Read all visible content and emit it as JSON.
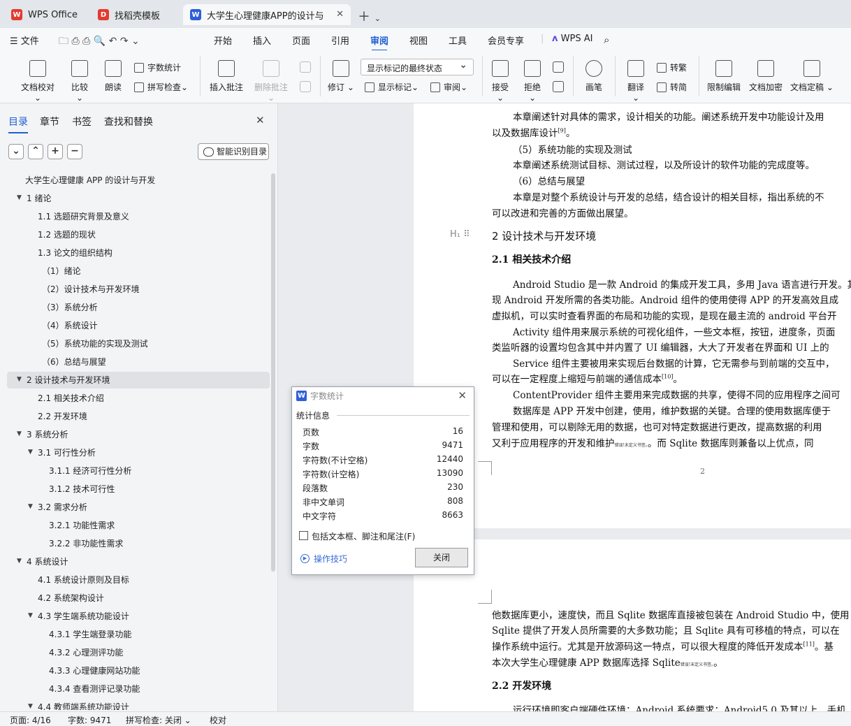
{
  "tabs": [
    {
      "label": "WPS Office",
      "color": "#e33b2e"
    },
    {
      "label": "找稻壳模板",
      "color": "#e33b2e"
    },
    {
      "label": "大学生心理健康APP的设计与",
      "color": "#2f5fd8"
    }
  ],
  "menu": {
    "file": "文件",
    "items": [
      "开始",
      "插入",
      "页面",
      "引用",
      "审阅",
      "视图",
      "工具",
      "会员专享"
    ],
    "active": "审阅",
    "wps_ai": "WPS AI"
  },
  "ribbon": {
    "doc_check": "文档校对",
    "compare": "比较",
    "read_aloud": "朗读",
    "word_count": "字数统计",
    "spell_check": "拼写检查",
    "insert_comment": "插入批注",
    "delete_comment": "删除批注",
    "revise": "修订",
    "markup_state": "显示标记的最终状态",
    "show_markup": "显示标记",
    "review": "审阅",
    "accept": "接受",
    "reject": "拒绝",
    "pen": "画笔",
    "translate": "翻译",
    "to_traditional": "转繁",
    "to_simplified": "转简",
    "restrict_edit": "限制编辑",
    "encrypt": "文档加密",
    "finalize": "文档定稿"
  },
  "sidebar": {
    "tabs": [
      "目录",
      "章节",
      "书签",
      "查找和替换"
    ],
    "smart_toc": "智能识别目录",
    "toc": [
      {
        "label": "大学生心理健康 APP 的设计与开发"
      },
      {
        "label": "1 绪论"
      },
      {
        "label": "1.1  选题研究背景及意义"
      },
      {
        "label": "1.2  选题的现状"
      },
      {
        "label": "1.3  论文的组织结构"
      },
      {
        "label": "（1）绪论"
      },
      {
        "label": "（2）设计技术与开发环境"
      },
      {
        "label": "（3）系统分析"
      },
      {
        "label": "（4）系统设计"
      },
      {
        "label": "（5）系统功能的实现及测试"
      },
      {
        "label": "（6）总结与展望"
      },
      {
        "label": "2 设计技术与开发环境"
      },
      {
        "label": "2.1 相关技术介绍"
      },
      {
        "label": "2.2 开发环境"
      },
      {
        "label": "3 系统分析"
      },
      {
        "label": "3.1 可行性分析"
      },
      {
        "label": "3.1.1 经济可行性分析"
      },
      {
        "label": "3.1.2 技术可行性"
      },
      {
        "label": "3.2 需求分析"
      },
      {
        "label": "3.2.1 功能性需求"
      },
      {
        "label": "3.2.2  非功能性需求"
      },
      {
        "label": "4 系统设计"
      },
      {
        "label": "4.1 系统设计原则及目标"
      },
      {
        "label": "4.2  系统架构设计"
      },
      {
        "label": "4.3 学生端系统功能设计"
      },
      {
        "label": "4.3.1 学生端登录功能"
      },
      {
        "label": "4.3.2 心理测评功能"
      },
      {
        "label": "4.3.3 心理健康网站功能"
      },
      {
        "label": "4.3.4  查看测评记录功能"
      },
      {
        "label": "4.4 教师端系统功能设计"
      }
    ]
  },
  "document": {
    "p1": "本章阐述针对具体的需求，设计相关的功能。阐述系统开发中功能设计及用",
    "p1b": "以及数据库设计",
    "ref9": "[9]",
    "h5": "（5）系统功能的实现及测试",
    "p2": "本章阐述系统测试目标、测试过程，以及所设计的软件功能的完成度等。",
    "h6": "（6）总结与展望",
    "p3": "本章是对整个系统设计与开发的总结，结合设计的相关目标，指出系统的不",
    "p3b": "可以改进和完善的方面做出展望。",
    "heading2": "2 设计技术与开发环境",
    "heading21": "2.1 相关技术介绍",
    "l1": "Android Studio 是一款 Android 的集成开发工具，多用 Java 语言进行开发。其",
    "l2": "现 Android 开发所需的各类功能。Android 组件的使用使得 APP 的开发高效且成",
    "l3": "虚拟机，可以实时查看界面的布局和功能的实现，是现在最主流的 android 平台开",
    "l4": "Activity 组件用来展示系统的可视化组件，一些文本框，按钮，进度条，页面",
    "l5": "类监听器的设置均包含其中并内置了 UI 编辑器，大大了开发者在界面和 UI 上的",
    "l6": "Service 组件主要被用来实现后台数据的计算，它无需参与到前端的交互中，",
    "l7": "可以在一定程度上缩短与前端的通信成本",
    "ref10": "[10]",
    "l8": "ContentProvider 组件主要用来完成数据的共享，使得不同的应用程序之间可",
    "l9": "数据库是 APP 开发中创建，使用，维护数据的关键。合理的使用数据库便于",
    "l10": "管理和使用，可以剔除无用的数据，也可对特定数据进行更改，提高数据的利用",
    "l11": "又利于应用程序的开发和维护",
    "err1": "错误!未定义书签。",
    "l11b": "。而 Sqlite 数据库则兼备以上优点，同",
    "page_number": "2",
    "m1": "他数据库更小，速度快，而且 Sqlite 数据库直接被包装在 Android Studio 中，使用",
    "m2": "Sqlite 提供了开发人员所需要的大多数功能；且 Sqlite 具有可移植的特点，可以在",
    "m3": "操作系统中运行。尤其是开放源码这一特点，可以很大程度的降低开发成本",
    "ref11": "[11]",
    "m3b": "。基",
    "m4": "本次大学生心理健康 APP 数据库选择 Sqlite",
    "err2": "错误!未定义书签。",
    "m4b": "。",
    "heading22": "2.2 开发环境",
    "m5": "运行环境即客户端硬件环境：Android 系统要求：Android5.0 及其以上，手机"
  },
  "dialog": {
    "title": "字数统计",
    "group": "统计信息",
    "stats": [
      {
        "label": "页数",
        "value": "16"
      },
      {
        "label": "字数",
        "value": "9471"
      },
      {
        "label": "字符数(不计空格)",
        "value": "12440"
      },
      {
        "label": "字符数(计空格)",
        "value": "13090"
      },
      {
        "label": "段落数",
        "value": "230"
      },
      {
        "label": "非中文单词",
        "value": "808"
      },
      {
        "label": "中文字符",
        "value": "8663"
      }
    ],
    "checkbox": "包括文本框、脚注和尾注(F)",
    "tips": "操作技巧",
    "close": "关闭"
  },
  "status": {
    "page": "页面: 4/16",
    "words": "字数: 9471",
    "spell": "拼写检查: 关闭",
    "proof": "校对"
  }
}
